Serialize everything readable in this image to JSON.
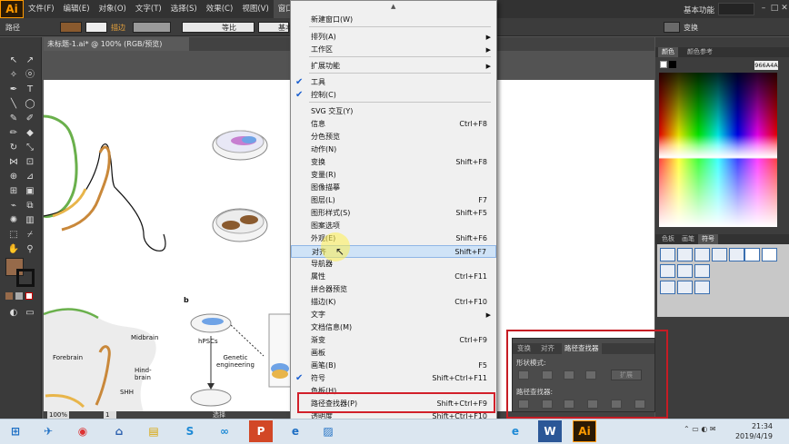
{
  "app": {
    "logo": "Ai"
  },
  "menubar": {
    "items": [
      "文件(F)",
      "编辑(E)",
      "对象(O)",
      "文字(T)",
      "选择(S)",
      "效果(C)",
      "视图(V)",
      "窗口(W)"
    ],
    "active_index": 7,
    "workspace_label": "基本功能"
  },
  "control_bar": {
    "object_label": "路径",
    "opacity_label": "描边",
    "stroke1_label": "等比",
    "stroke2_label": "基本"
  },
  "document_tab": {
    "label": "未标题-1.ai* @ 100% (RGB/预览)"
  },
  "window_menu": {
    "items": [
      {
        "label": "新建窗口(W)",
        "shortcut": "",
        "submenu": false,
        "checked": false
      },
      {
        "label": "排列(A)",
        "shortcut": "",
        "submenu": true,
        "checked": false
      },
      {
        "label": "工作区",
        "shortcut": "",
        "submenu": true,
        "checked": false
      },
      {
        "label": "扩展功能",
        "shortcut": "",
        "submenu": true,
        "checked": false
      },
      {
        "label": "工具",
        "shortcut": "",
        "submenu": false,
        "checked": true
      },
      {
        "label": "控制(C)",
        "shortcut": "",
        "submenu": false,
        "checked": true
      },
      {
        "label": "SVG 交互(Y)",
        "shortcut": "",
        "submenu": false,
        "checked": false
      },
      {
        "label": "信息",
        "shortcut": "Ctrl+F8",
        "submenu": false,
        "checked": false
      },
      {
        "label": "分色预览",
        "shortcut": "",
        "submenu": false,
        "checked": false
      },
      {
        "label": "动作(N)",
        "shortcut": "",
        "submenu": false,
        "checked": false
      },
      {
        "label": "变换",
        "shortcut": "Shift+F8",
        "submenu": false,
        "checked": false
      },
      {
        "label": "变量(R)",
        "shortcut": "",
        "submenu": false,
        "checked": false
      },
      {
        "label": "图像描摹",
        "shortcut": "",
        "submenu": false,
        "checked": false
      },
      {
        "label": "图层(L)",
        "shortcut": "F7",
        "submenu": false,
        "checked": false
      },
      {
        "label": "图形样式(S)",
        "shortcut": "Shift+F5",
        "submenu": false,
        "checked": false
      },
      {
        "label": "图案选项",
        "shortcut": "",
        "submenu": false,
        "checked": false
      },
      {
        "label": "外观(E)",
        "shortcut": "Shift+F6",
        "submenu": false,
        "checked": false
      },
      {
        "label": "对齐",
        "shortcut": "Shift+F7",
        "submenu": false,
        "checked": false,
        "highlighted": true
      },
      {
        "label": "导航器",
        "shortcut": "",
        "submenu": false,
        "checked": false
      },
      {
        "label": "属性",
        "shortcut": "Ctrl+F11",
        "submenu": false,
        "checked": false
      },
      {
        "label": "拼合器预览",
        "shortcut": "",
        "submenu": false,
        "checked": false
      },
      {
        "label": "描边(K)",
        "shortcut": "Ctrl+F10",
        "submenu": false,
        "checked": false
      },
      {
        "label": "文字",
        "shortcut": "",
        "submenu": true,
        "checked": false
      },
      {
        "label": "文档信息(M)",
        "shortcut": "",
        "submenu": false,
        "checked": false
      },
      {
        "label": "渐变",
        "shortcut": "Ctrl+F9",
        "submenu": false,
        "checked": false
      },
      {
        "label": "画板",
        "shortcut": "",
        "submenu": false,
        "checked": false
      },
      {
        "label": "画笔(B)",
        "shortcut": "F5",
        "submenu": false,
        "checked": false
      },
      {
        "label": "符号",
        "shortcut": "Shift+Ctrl+F11",
        "submenu": false,
        "checked": true
      },
      {
        "label": "色板(H)",
        "shortcut": "",
        "submenu": false,
        "checked": false
      },
      {
        "label": "路径查找器(P)",
        "shortcut": "Shift+Ctrl+F9",
        "submenu": false,
        "checked": false,
        "boxed": true
      },
      {
        "label": "透明度",
        "shortcut": "Shift+Ctrl+F10",
        "submenu": false,
        "checked": false
      }
    ]
  },
  "color_panel": {
    "tabs": [
      "颜色",
      "颜色参考"
    ],
    "hex_value": "966A4A"
  },
  "symbol_panel": {
    "tabs": [
      "色板",
      "画笔",
      "符号"
    ]
  },
  "pathfinder_panel": {
    "tabs": [
      "变换",
      "对齐",
      "路径查找器"
    ],
    "shape_modes_label": "形状模式:",
    "expand_label": "扩展",
    "pathfinders_label": "路径查找器:"
  },
  "artwork": {
    "labels": [
      "b",
      "Forebrain",
      "Midbrain",
      "Hind-\nbrain",
      "SHH",
      "hPSCs",
      "Genetic\nengineering"
    ]
  },
  "status_bar": {
    "zoom": "100%",
    "page": "1",
    "tool": "选择"
  },
  "taskbar": {
    "time": "21:34",
    "date": "2019/4/19"
  },
  "colors": {
    "menu_bg": "#f0f0f0",
    "highlight": "#cfe3f7",
    "annotation_red": "#d2202a",
    "brown_fill": "#966A4A"
  }
}
